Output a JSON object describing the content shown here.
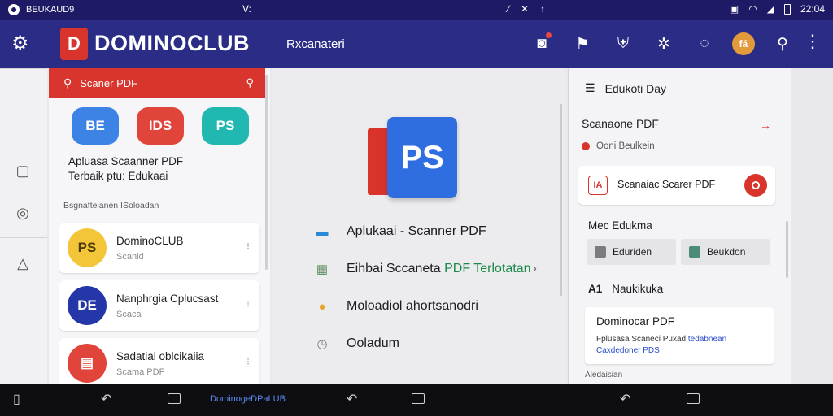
{
  "status": {
    "left_text": "BEUKAUD9",
    "mid_text": "V:",
    "right_time": "22:04"
  },
  "appbar": {
    "logo_letter": "D",
    "brand": "DOMINOCLUB",
    "subtitle": "Rxcanateri",
    "avatar_text": "fá"
  },
  "left": {
    "search_label": "Scaner PDF",
    "apps": [
      {
        "label": "BE",
        "color": "#3d83e6"
      },
      {
        "label": "IDS",
        "color": "#e0443a"
      },
      {
        "label": "PS",
        "color": "#20b8b0"
      }
    ],
    "promo_line1": "Apluasa Scaanner PDF",
    "promo_line2": "Terbaik ptu: Edukaai",
    "section": "Bsgnafteianen ISoloadan",
    "cards": [
      {
        "title": "DominoCLUB",
        "subtitle": "Scanid",
        "icon": "PS",
        "icon_color": "#f3c63a",
        "icon_text_color": "#4d3a08"
      },
      {
        "title": "Nanphrgia Cplucsast",
        "subtitle": "Scaca",
        "icon": "DE",
        "icon_color": "#2436a8",
        "icon_text_color": "#ffffff"
      },
      {
        "title": "Sadatial oblcikaiia",
        "subtitle": "Scama PDF",
        "icon": "▤",
        "icon_color": "#e0443a",
        "icon_text_color": "#ffffff"
      }
    ]
  },
  "center": {
    "hero_icon": "PS",
    "menu": [
      {
        "icon": "folder-icon",
        "glyph": "▬",
        "glyph_color": "#2a8ad6",
        "label": "Aplukaai - Scanner PDF",
        "label_green": "",
        "chevron": ""
      },
      {
        "icon": "grid-icon",
        "glyph": "▦",
        "glyph_color": "#5a8a5a",
        "label": "Eihbai Sccaneta",
        "label_green": "PDF Terlotatan",
        "chevron": "›"
      },
      {
        "icon": "orange-circle-icon",
        "glyph": "●",
        "glyph_color": "#e7a628",
        "label": "Moloadiol ahortsanodri",
        "label_green": "",
        "chevron": ""
      },
      {
        "icon": "clock-icon",
        "glyph": "◷",
        "glyph_color": "#777777",
        "label": "Ooladum",
        "label_green": "",
        "chevron": ""
      }
    ]
  },
  "right": {
    "head": "Edukoti Day",
    "title": "Scanaone PDF",
    "sub": "Ooni Beulkein",
    "card_label": "Scanaiac Scarer PDF",
    "card_icon_label": "IA",
    "section2": "Mec Edukma",
    "chips": [
      {
        "label": "Eduriden",
        "color": "#7b7b80"
      },
      {
        "label": "Beukdon",
        "color": "#4d8a7a"
      }
    ],
    "section3_prefix": "A1",
    "section3": "Naukikuka",
    "card2_title": "Dominocar PDF",
    "card2_line1": "Fplusasa Scaneci Puxad",
    "card2_line1_blue": "tedabnean",
    "card2_line2_blue": "Caxdedoner PDS",
    "foot_left": "Aledaisian",
    "foot_right": "·"
  },
  "navbar": {
    "label": "DominogeDPaLUB"
  }
}
